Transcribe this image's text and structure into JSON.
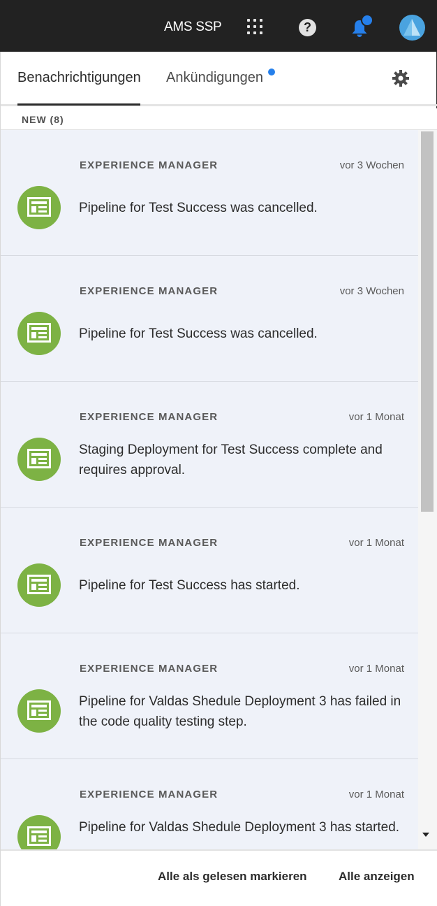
{
  "topbar": {
    "org_name": "AMS SSP",
    "apps_icon": "apps-grid-icon",
    "help_icon": "help-icon",
    "help_glyph": "?",
    "notifications_icon": "bell-icon",
    "avatar_icon": "user-avatar"
  },
  "tabs": {
    "notifications": "Benachrichtigungen",
    "announcements": "Ankündigungen",
    "settings_icon": "gear-icon"
  },
  "section": {
    "label": "NEW (8)"
  },
  "colors": {
    "accent": "#2680eb",
    "app_icon_bg": "#7db244",
    "item_bg": "#eff2f9"
  },
  "notifications": [
    {
      "source": "EXPERIENCE MANAGER",
      "time": "vor 3 Wochen",
      "message": "Pipeline for Test Success was cancelled.",
      "icon": "experience-manager-icon"
    },
    {
      "source": "EXPERIENCE MANAGER",
      "time": "vor 3 Wochen",
      "message": "Pipeline for Test Success was cancelled.",
      "icon": "experience-manager-icon"
    },
    {
      "source": "EXPERIENCE MANAGER",
      "time": "vor 1 Monat",
      "message": "Staging Deployment for Test Success complete and requires approval.",
      "icon": "experience-manager-icon"
    },
    {
      "source": "EXPERIENCE MANAGER",
      "time": "vor 1 Monat",
      "message": "Pipeline for Test Success has started.",
      "icon": "experience-manager-icon"
    },
    {
      "source": "EXPERIENCE MANAGER",
      "time": "vor 1 Monat",
      "message": "Pipeline for Valdas Shedule Deployment 3 has failed in the code quality testing step.",
      "icon": "experience-manager-icon"
    },
    {
      "source": "EXPERIENCE MANAGER",
      "time": "vor 1 Monat",
      "message": "Pipeline for Valdas Shedule Deployment 3 has started.",
      "icon": "experience-manager-icon"
    }
  ],
  "footer": {
    "mark_all_read": "Alle als gelesen markieren",
    "view_all": "Alle anzeigen"
  }
}
